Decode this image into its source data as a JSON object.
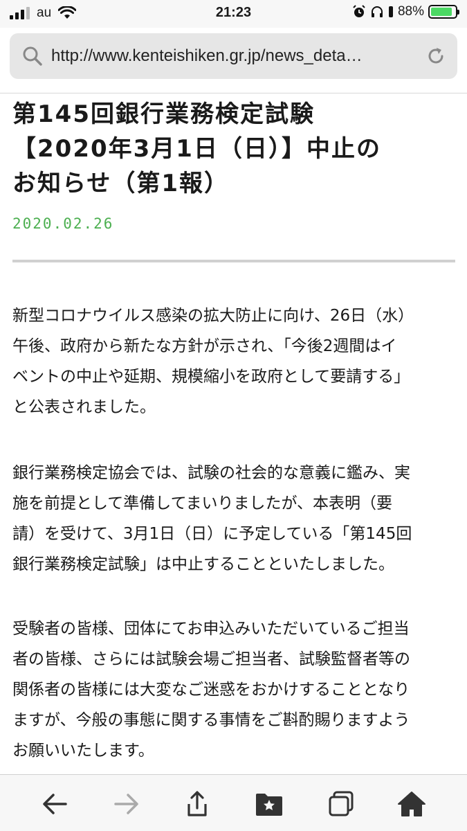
{
  "status": {
    "carrier": "au",
    "time": "21:23",
    "battery_pct": "88%",
    "battery_level": 0.88,
    "battery_color": "#4cd964"
  },
  "browser": {
    "url": "http://www.kenteishiken.gr.jp/news_deta…",
    "icons": [
      "search-icon",
      "reload-icon"
    ]
  },
  "article": {
    "title_lines": [
      "第145回銀行業務検定試験",
      "【2020年3月1日（日）】中止の",
      "お知らせ（第1報）"
    ],
    "date": "2020.02.26",
    "date_color": "#4caf50",
    "paragraphs": [
      [
        "新型コロナウイルス感染の拡大防止に向け、26日（水）",
        "午後、政府から新たな方針が示され、「今後2週間はイ",
        "ベントの中止や延期、規模縮小を政府として要請する」",
        "と公表されました。"
      ],
      [
        "銀行業務検定協会では、試験の社会的な意義に鑑み、実",
        "施を前提として準備してまいりましたが、本表明（要",
        "請）を受けて、3月1日（日）に予定している「第145回",
        "銀行業務検定試験」は中止することといたしました。"
      ],
      [
        "受験者の皆様、団体にてお申込みいただいているご担当",
        "者の皆様、さらには試験会場ご担当者、試験監督者等の",
        "関係者の皆様には大変なご迷惑をおかけすることとなり",
        "ますが、今般の事態に関する事情をご斟酌賜りますよう",
        "お願いいたします。"
      ]
    ]
  },
  "toolbar": {
    "icons": [
      "back-arrow-icon",
      "forward-arrow-icon",
      "share-icon",
      "bookmarks-icon",
      "tabs-icon",
      "home-icon"
    ]
  }
}
